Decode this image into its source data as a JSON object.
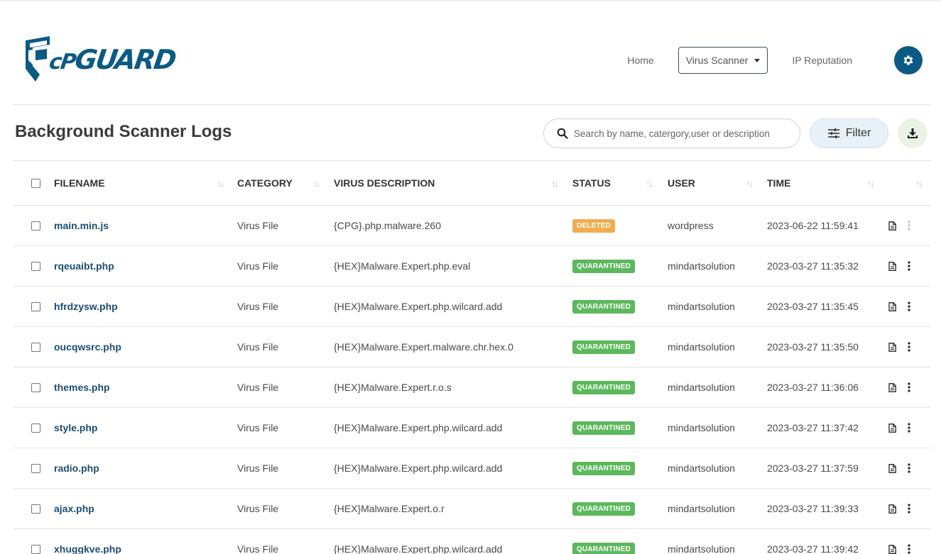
{
  "app": {
    "logo_text_prefix": "cP",
    "logo_text_suffix": "GUARD",
    "brand_color": "#0b5a84"
  },
  "nav": {
    "home": "Home",
    "virus_scanner": "Virus Scanner",
    "ip_reputation": "IP Reputation",
    "settings_icon": "gear-icon"
  },
  "page": {
    "title": "Background Scanner Logs"
  },
  "toolbar": {
    "search_placeholder": "Search by name, catergory,user or description",
    "filter_label": "Filter",
    "download_icon": "download-icon"
  },
  "table": {
    "columns": {
      "filename": "FILENAME",
      "category": "CATEGORY",
      "virus_description": "VIRUS DESCRIPTION",
      "status": "STATUS",
      "user": "USER",
      "time": "TIME"
    },
    "status_colors": {
      "DELETED": "#f0ad4e",
      "QUARANTINED": "#5cb85c"
    },
    "rows": [
      {
        "filename": "main.min.js",
        "category": "Virus File",
        "description": "{CPG}.php.malware.260",
        "status": "DELETED",
        "user": "wordpress",
        "time": "2023-06-22 11:59:41"
      },
      {
        "filename": "rqeuaibt.php",
        "category": "Virus File",
        "description": "{HEX}Malware.Expert.php.eval",
        "status": "QUARANTINED",
        "user": "mindartsolution",
        "time": "2023-03-27 11:35:32"
      },
      {
        "filename": "hfrdzysw.php",
        "category": "Virus File",
        "description": "{HEX}Malware.Expert.php.wilcard.add",
        "status": "QUARANTINED",
        "user": "mindartsolution",
        "time": "2023-03-27 11:35:45"
      },
      {
        "filename": "oucqwsrc.php",
        "category": "Virus File",
        "description": "{HEX}Malware.Expert.malware.chr.hex.0",
        "status": "QUARANTINED",
        "user": "mindartsolution",
        "time": "2023-03-27 11:35:50"
      },
      {
        "filename": "themes.php",
        "category": "Virus File",
        "description": "{HEX}Malware.Expert.r.o.s",
        "status": "QUARANTINED",
        "user": "mindartsolution",
        "time": "2023-03-27 11:36:06"
      },
      {
        "filename": "style.php",
        "category": "Virus File",
        "description": "{HEX}Malware.Expert.php.wilcard.add",
        "status": "QUARANTINED",
        "user": "mindartsolution",
        "time": "2023-03-27 11:37:42"
      },
      {
        "filename": "radio.php",
        "category": "Virus File",
        "description": "{HEX}Malware.Expert.php.wilcard.add",
        "status": "QUARANTINED",
        "user": "mindartsolution",
        "time": "2023-03-27 11:37:59"
      },
      {
        "filename": "ajax.php",
        "category": "Virus File",
        "description": "{HEX}Malware.Expert.o.r",
        "status": "QUARANTINED",
        "user": "mindartsolution",
        "time": "2023-03-27 11:39:33"
      },
      {
        "filename": "xhuggkve.php",
        "category": "Virus File",
        "description": "{HEX}Malware.Expert.php.wilcard.add",
        "status": "QUARANTINED",
        "user": "mindartsolution",
        "time": "2023-03-27 11:39:42"
      }
    ]
  }
}
